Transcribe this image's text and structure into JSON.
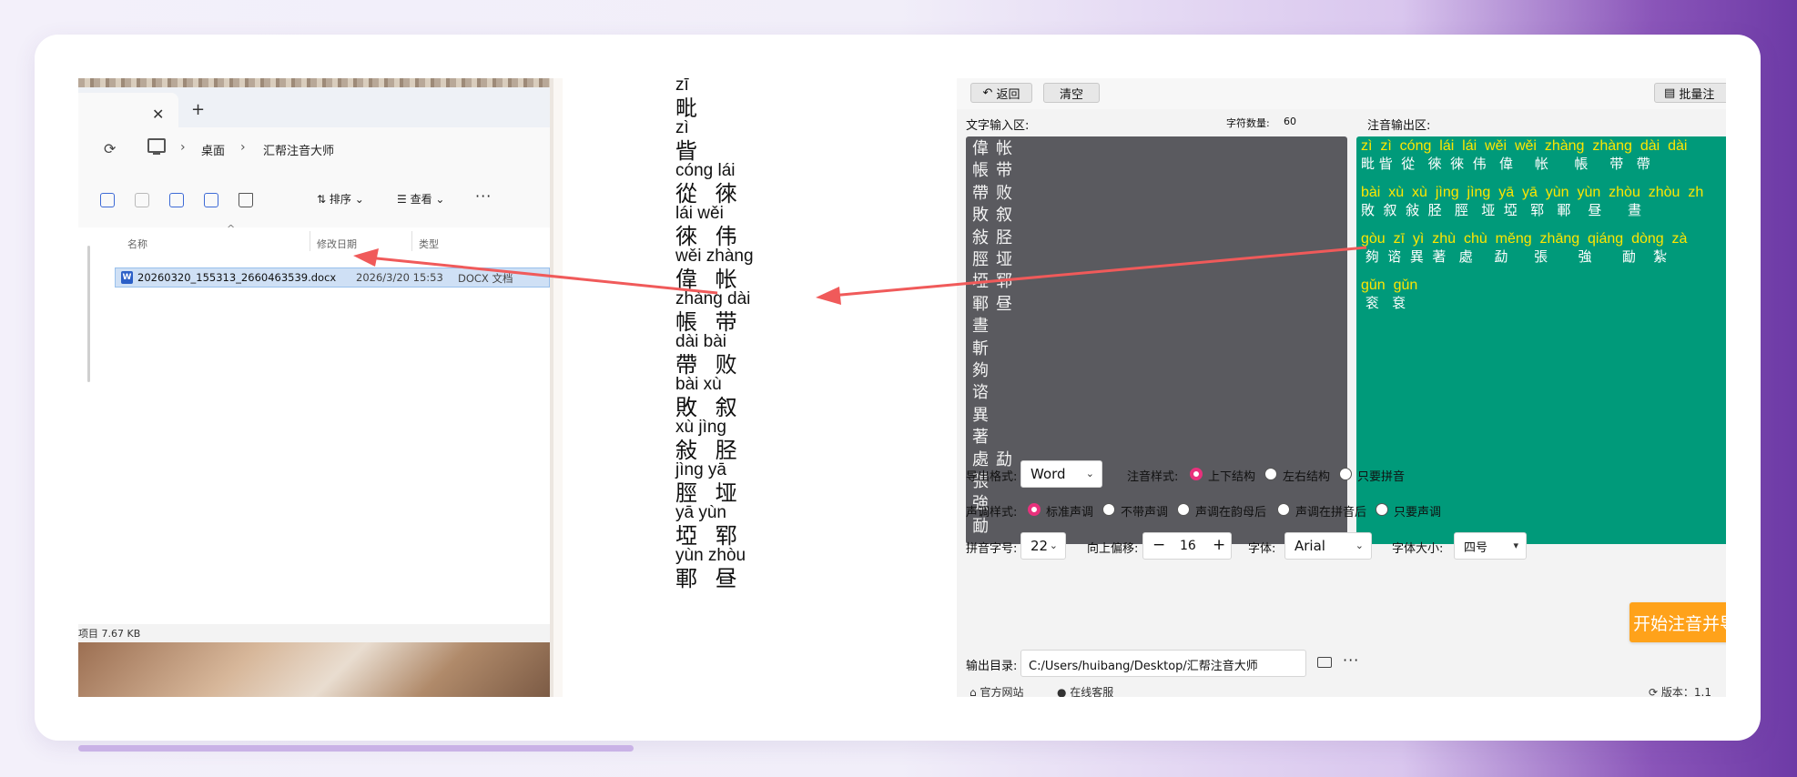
{
  "explorer": {
    "tab_close": "✕",
    "tab_new": "+",
    "breadcrumb": [
      "桌面",
      "汇帮注音大师"
    ],
    "toolbar": {
      "sort": "排序",
      "view": "查看",
      "more": "···"
    },
    "columns": {
      "name": "名称",
      "date": "修改日期",
      "type": "类型"
    },
    "file": {
      "name": "20260320_155313_2660463539.docx",
      "date": "2026/3/20 15:53",
      "type": "DOCX 文档"
    },
    "status": "项目  7.67 KB"
  },
  "document": {
    "items": [
      {
        "py": "zī",
        "hz": ""
      },
      {
        "py": "",
        "hz": "毗"
      },
      {
        "py": "zì",
        "hz": ""
      },
      {
        "py": "",
        "hz": "眥"
      },
      {
        "py": "cóng lái",
        "hz": " 從 徠"
      },
      {
        "py": "lái wěi",
        "hz": "徠 伟"
      },
      {
        "py": "wěi zhàng",
        "hz": " 偉  帐"
      },
      {
        "py": "zhàng dài",
        "hz": "  帳  带"
      },
      {
        "py": "dài bài",
        "hz": "帶 败"
      },
      {
        "py": "bài xù",
        "hz": "敗 叙"
      },
      {
        "py": "xù jìng",
        "hz": "敍 胫"
      },
      {
        "py": "jìng yā",
        "hz": " 脛 垭"
      },
      {
        "py": "yā yùn",
        "hz": "埡 郓"
      },
      {
        "py": "yùn zhòu",
        "hz": "鄆  昼"
      }
    ]
  },
  "app": {
    "back_label": "返回",
    "clear_label": "清空",
    "batch_label": "批量注",
    "input_label": "文字输入区:",
    "char_count_label": "字符数量:",
    "char_count": "60",
    "output_label": "注音输出区:",
    "input_columns": [
      [
        "偉",
        "帳",
        "帶",
        "敗",
        "敍",
        "脛",
        "埡",
        "鄆",
        "晝",
        "斬",
        "夠",
        "谘",
        "異",
        "著",
        "處",
        "張",
        "強",
        "勔"
      ],
      [
        "帐",
        "带",
        "败",
        "叙",
        "胫",
        "垭",
        "郓",
        "昼",
        "",
        "",
        "",
        "",
        "",
        "",
        "勐",
        "",
        "",
        ""
      ]
    ],
    "output_lines": [
      {
        "py": "zì  zì  cóng  lái  lái  wěi  wěi  zhàng  zhàng  dài  dài",
        "hz": "毗 眥  從   徠  徠  伟   偉     帐      帳     带   帶"
      },
      {
        "py": "bài  xù  xù  jìng  jìng  yā  yā  yùn  yùn  zhòu  zhòu  zh",
        "hz": "敗  叙  敍  胫   脛   垭  埡   郓   鄆    昼      晝      "
      },
      {
        "py": "gòu  zī  yì  zhù  chù  měng  zhāng  qiáng  dòng  zà",
        "hz": " 夠  谘  異  著   處     勐      張       強       勔    紮"
      },
      {
        "py": "gǔn  gǔn",
        "hz": " 衮   袞"
      }
    ],
    "export_format_label": "导出格式:",
    "export_format_value": "Word",
    "annot_style_label": "注音样式:",
    "annot_style_options": [
      "上下结构",
      "左右结构",
      "只要拼音"
    ],
    "tone_style_label": "声调样式:",
    "tone_style_options": [
      "标准声调",
      "不带声调",
      "声调在韵母后",
      "声调在拼音后",
      "只要声调"
    ],
    "pinyin_size_label": "拼音字号:",
    "pinyin_size_value": "22",
    "offset_label": "向上偏移:",
    "offset_value": "16",
    "step_minus": "−",
    "step_plus": "+",
    "font_label": "字体:",
    "font_value": "Arial",
    "font_size_label": "字体大小:",
    "font_size_value": "四号",
    "start_label": "开始注音并导出",
    "output_dir_label": "输出目录:",
    "output_dir_value": "C:/Users/huibang/Desktop/汇帮注音大师",
    "more": "···",
    "footer_left": "官方网站",
    "footer_mid": "在线客服",
    "footer_right": "版本：1.1"
  },
  "colors": {
    "accent_pink": "#e8317c",
    "start_orange": "#ffa21a",
    "output_green": "#009a7a",
    "pinyin_yellow": "#ffe600",
    "input_grey": "#5a5a5f",
    "arrow_red": "#f05a5a"
  }
}
